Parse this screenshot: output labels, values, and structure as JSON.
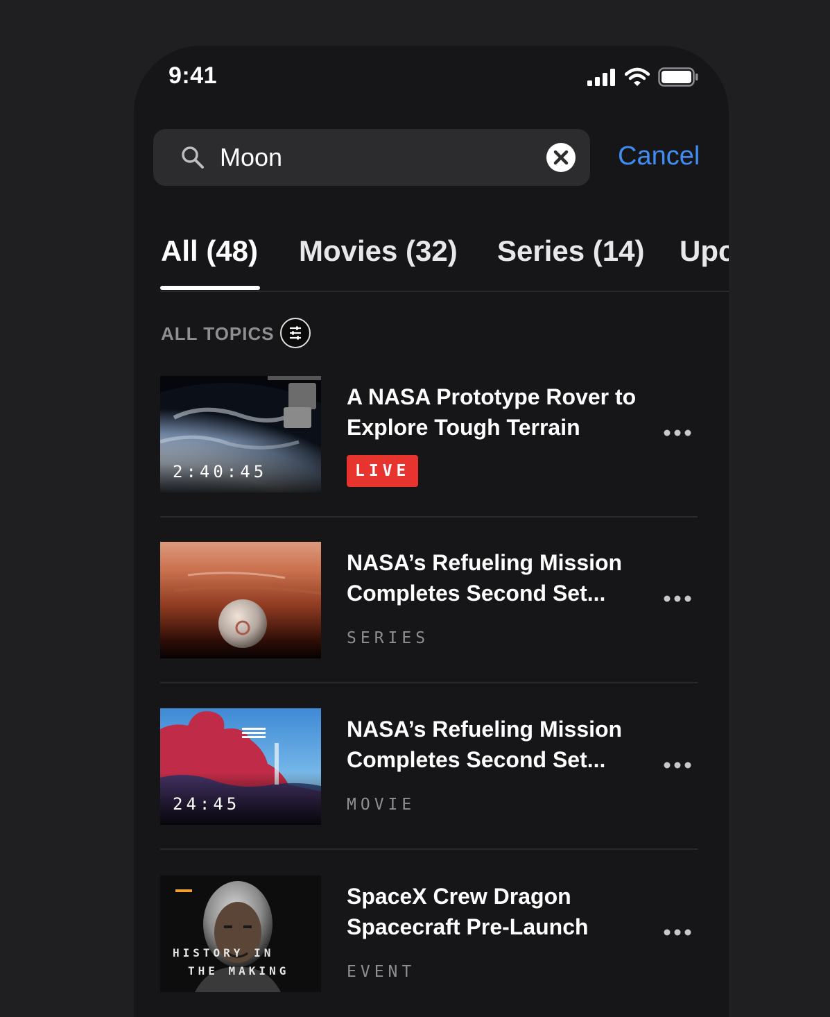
{
  "status_bar": {
    "time": "9:41"
  },
  "search": {
    "value": "Moon",
    "placeholder": "",
    "cancel_label": "Cancel"
  },
  "tabs": [
    {
      "label": "All (48)",
      "active": true
    },
    {
      "label": "Movies (32)",
      "active": false
    },
    {
      "label": "Series (14)",
      "active": false
    },
    {
      "label": "Upc",
      "active": false
    }
  ],
  "topics": {
    "label": "ALL TOPICS"
  },
  "results": [
    {
      "title": "A NASA Prototype Rover to Explore Tough Terrain",
      "duration": "2:40:45",
      "badge": "LIVE",
      "meta": ""
    },
    {
      "title": "NASA’s Refueling Mission Completes Second Set...",
      "duration": "",
      "badge": "",
      "meta": "SERIES"
    },
    {
      "title": "NASA’s Refueling Mission Completes Second Set...",
      "duration": "24:45",
      "badge": "",
      "meta": "MOVIE"
    },
    {
      "title": "SpaceX Crew Dragon Spacecraft Pre-Launch",
      "duration": "",
      "badge": "",
      "meta": "EVENT",
      "thumb_text_1": "HISTORY IN",
      "thumb_text_2": "THE MAKING"
    }
  ],
  "colors": {
    "accent": "#3f8cf2",
    "live": "#e8342f",
    "background": "#161618"
  }
}
